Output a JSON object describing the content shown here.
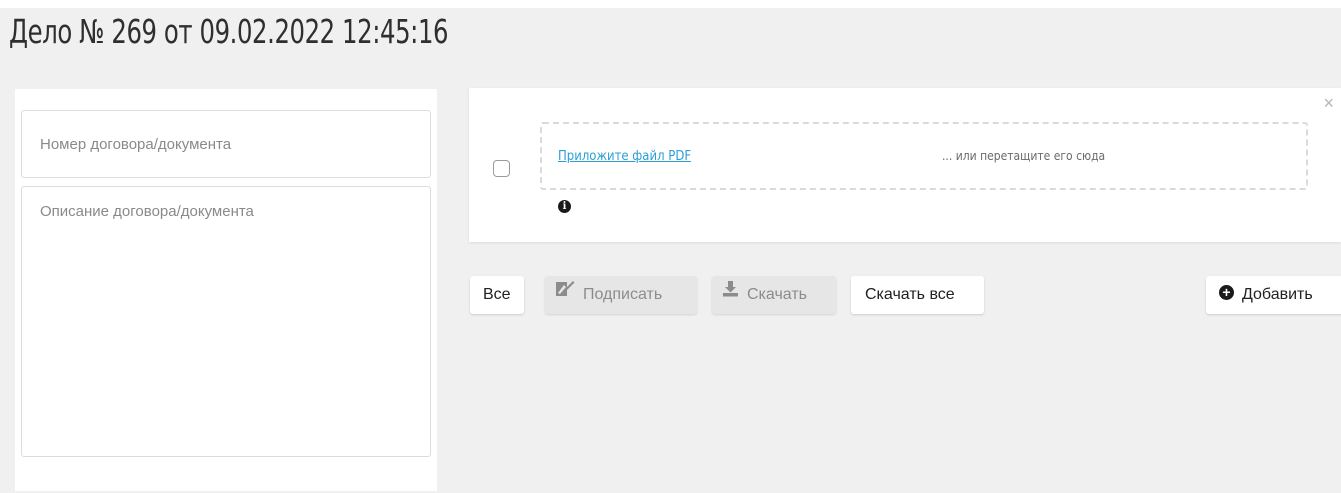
{
  "header": {
    "title": "Дело № 269 от 09.02.2022 12:45:16"
  },
  "form": {
    "doc_number_placeholder": "Номер договора/документа",
    "doc_description_placeholder": "Описание договора/документа"
  },
  "upload": {
    "attach_link": "Приложите файл PDF",
    "drag_hint": "... или перетащите его сюда",
    "close_symbol": "×",
    "info_symbol": "i"
  },
  "toolbar": {
    "all_label": "Все",
    "sign_label": "Подписать",
    "download_label": "Скачать",
    "download_all_label": "Скачать все",
    "add_label": "Добавить"
  },
  "icons": {
    "close": "close-icon",
    "info": "info-icon",
    "sign": "signature-icon",
    "download": "download-icon",
    "add": "plus-circle-icon"
  },
  "colors": {
    "link": "#2a9fd6",
    "page_background": "#f0f0f0",
    "disabled_button": "#e6e6e6"
  }
}
